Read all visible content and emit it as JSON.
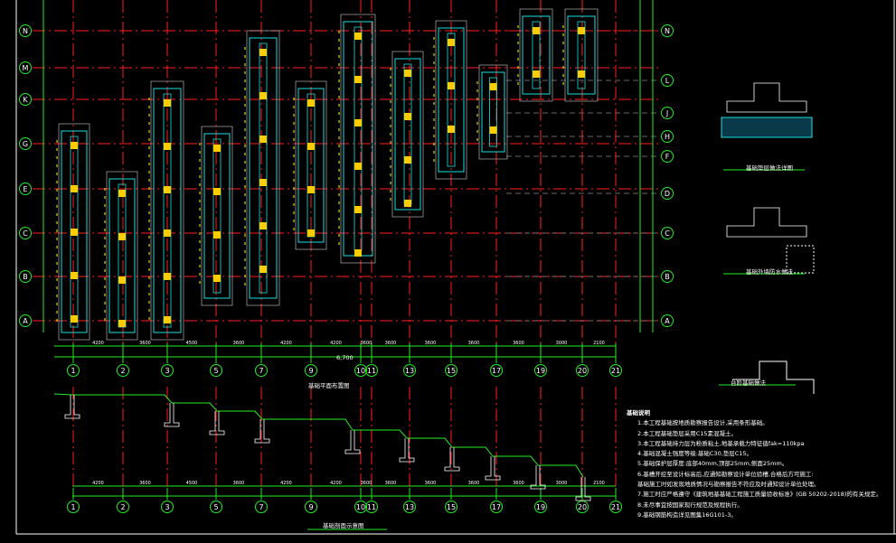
{
  "drawing": {
    "plan_title": "基础平面布置图",
    "section_title": "基础剖面示意图",
    "detail_titles": [
      "基础垫层做法详图",
      "基础外墙防水做法",
      "台阶基础做法"
    ],
    "total_dim": "6,700"
  },
  "axes": {
    "left": [
      "N",
      "M",
      "K",
      "G",
      "E",
      "C",
      "B",
      "A"
    ],
    "right": [
      "N",
      "L",
      "J",
      "H",
      "F",
      "D",
      "C",
      "B",
      "A"
    ],
    "bottom": [
      "1",
      "2",
      "3",
      "5",
      "7",
      "9",
      "10",
      "11",
      "13",
      "15",
      "17",
      "19",
      "20",
      "21"
    ],
    "bottom_dims": [
      "4200",
      "3600",
      "4500",
      "3600",
      "4200",
      "4200",
      "3600",
      "3600",
      "3600",
      "3600",
      "3600",
      "3000",
      "2100"
    ]
  },
  "notes": {
    "title": "基础说明",
    "items": [
      "1.本工程基础按地质勘察报告设计,采用条形基础。",
      "2.本工程基础垫层采用C15素混凝土。",
      "3.本工程基础持力层为粉质粘土,地基承载力特征值fak=110kpa",
      "4.基础混凝土强度等级:基础C30,垫层C15。",
      "5.基础保护层厚度:底部40mm,顶部25mm,侧面25mm。",
      "6.基槽开挖至设计标高后,应通知勘察设计单位验槽,合格后方可施工:",
      "  基础施工时如发现地质情况与勘察报告不符应及时通知设计单位处理。",
      "7.施工时应严格遵守《建筑地基基础工程施工质量验收标准》(GB 50202-2018)的有关规定。",
      "8.未尽事宜按国家现行规范及规程执行。",
      "9.基础钢筋构造详见图集16G101-3。"
    ]
  },
  "colors": {
    "grid": "#ff2020",
    "axis": "#22ee22",
    "foundation": "#18e0e0",
    "text": "#ffffff",
    "label": "#ffff00"
  }
}
